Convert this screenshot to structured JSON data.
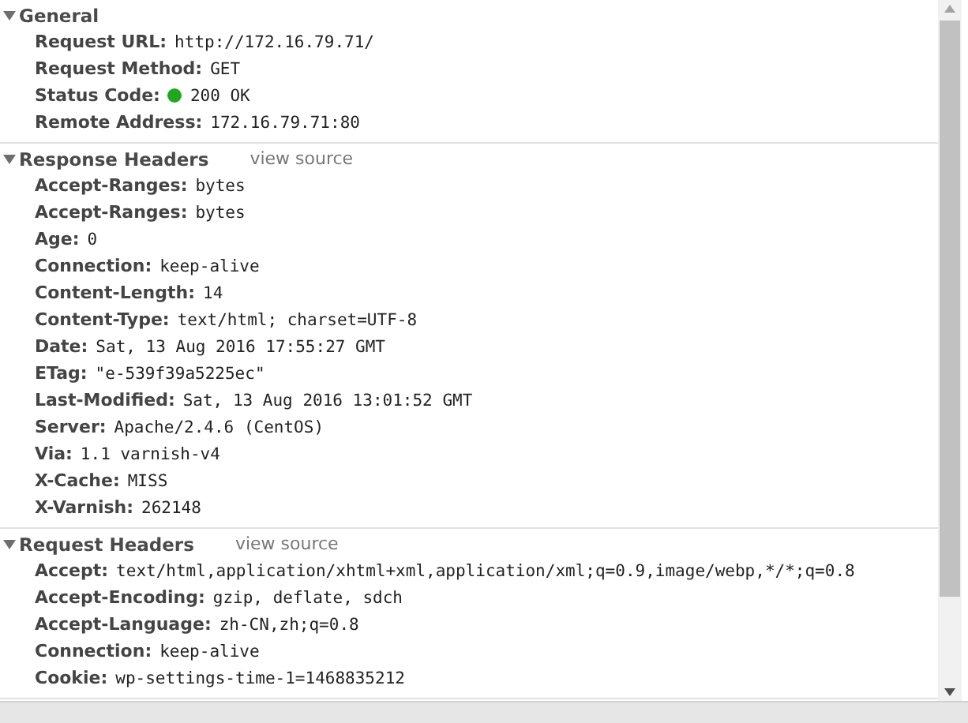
{
  "sections": [
    {
      "title": "General",
      "expanded": true,
      "rows": [
        {
          "name": "Request URL:",
          "value": "http://172.16.79.71/"
        },
        {
          "name": "Request Method:",
          "value": "GET"
        },
        {
          "name": "Status Code:",
          "value": "200 OK",
          "color": "#1fa81f"
        },
        {
          "name": "Remote Address:",
          "value": "172.16.79.71:80"
        }
      ]
    },
    {
      "title": "Response Headers",
      "expanded": true,
      "link": "view source",
      "rows": [
        {
          "name": "Accept-Ranges:",
          "value": "bytes"
        },
        {
          "name": "Accept-Ranges:",
          "value": "bytes"
        },
        {
          "name": "Age:",
          "value": "0"
        },
        {
          "name": "Connection:",
          "value": "keep-alive"
        },
        {
          "name": "Content-Length:",
          "value": "14"
        },
        {
          "name": "Content-Type:",
          "value": "text/html; charset=UTF-8"
        },
        {
          "name": "Date:",
          "value": "Sat, 13 Aug 2016 17:55:27 GMT"
        },
        {
          "name": "ETag:",
          "value": "\"e-539f39a5225ec\""
        },
        {
          "name": "Last-Modified:",
          "value": "Sat, 13 Aug 2016 13:01:52 GMT"
        },
        {
          "name": "Server:",
          "value": "Apache/2.4.6 (CentOS)"
        },
        {
          "name": "Via:",
          "value": "1.1 varnish-v4"
        },
        {
          "name": "X-Cache:",
          "value": "MISS"
        },
        {
          "name": "X-Varnish:",
          "value": "262148"
        }
      ]
    },
    {
      "title": "Request Headers",
      "expanded": true,
      "link": "view source",
      "rows": [
        {
          "name": "Accept:",
          "value": "text/html,application/xhtml+xml,application/xml;q=0.9,image/webp,*/*;q=0.8"
        },
        {
          "name": "Accept-Encoding:",
          "value": "gzip, deflate, sdch"
        },
        {
          "name": "Accept-Language:",
          "value": "zh-CN,zh;q=0.8"
        },
        {
          "name": "Connection:",
          "value": "keep-alive"
        },
        {
          "name": "Cookie:",
          "value": "wp-settings-time-1=1468835212"
        }
      ]
    }
  ]
}
